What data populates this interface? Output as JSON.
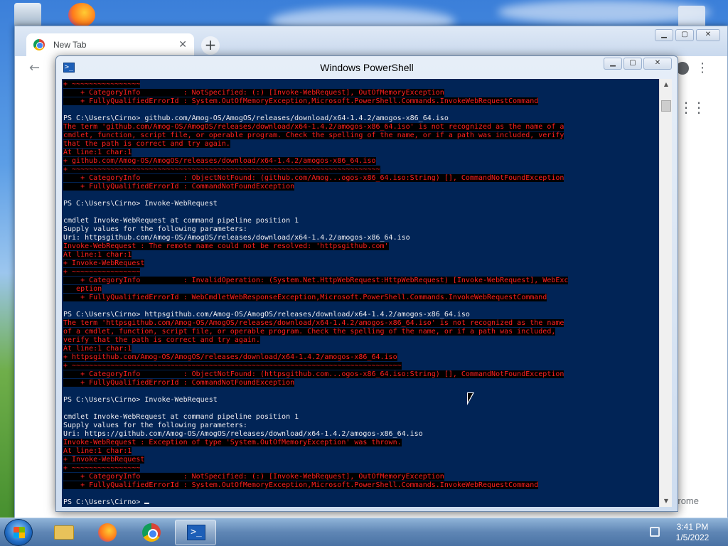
{
  "chrome": {
    "tab_title": "New Tab",
    "tab_close": "✕",
    "new_tab": "+",
    "back": "←",
    "menu": "⋮",
    "apps": "⋮⋮⋮",
    "footer_text": "rome"
  },
  "powershell": {
    "title": "Windows PowerShell",
    "icon": ">_",
    "lines": [
      {
        "t": "+ ~~~~~~~~~~~~~~~~",
        "e": true
      },
      {
        "t": "    + CategoryInfo          : NotSpecified: (:) [Invoke-WebRequest], OutOfMemoryException",
        "e": true
      },
      {
        "t": "    + FullyQualifiedErrorId : System.OutOfMemoryException,Microsoft.PowerShell.Commands.InvokeWebRequestCommand",
        "e": true
      },
      {
        "t": "",
        "e": false
      },
      {
        "t": "PS C:\\Users\\Cirno> github.com/Amog-OS/AmogOS/releases/download/x64-1.4.2/amogos-x86_64.iso",
        "e": false
      },
      {
        "t": "The term 'github.com/Amog-OS/AmogOS/releases/download/x64-1.4.2/amogos-x86_64.iso' is not recognized as the name of a",
        "e": true
      },
      {
        "t": "cmdlet, function, script file, or operable program. Check the spelling of the name, or if a path was included, verify",
        "e": true
      },
      {
        "t": "that the path is correct and try again.",
        "e": true
      },
      {
        "t": "At line:1 char:1",
        "e": true
      },
      {
        "t": "+ github.com/Amog-OS/AmogOS/releases/download/x64-1.4.2/amogos-x86_64.iso",
        "e": true
      },
      {
        "t": "+ ~~~~~~~~~~~~~~~~~~~~~~~~~~~~~~~~~~~~~~~~~~~~~~~~~~~~~~~~~~~~~~~~~~~~~~~~",
        "e": true
      },
      {
        "t": "    + CategoryInfo          : ObjectNotFound: (github.com/Amog...ogos-x86_64.iso:String) [], CommandNotFoundException",
        "e": true
      },
      {
        "t": "    + FullyQualifiedErrorId : CommandNotFoundException",
        "e": true
      },
      {
        "t": "",
        "e": false
      },
      {
        "t": "PS C:\\Users\\Cirno> Invoke-WebRequest",
        "e": false
      },
      {
        "t": "",
        "e": false
      },
      {
        "t": "cmdlet Invoke-WebRequest at command pipeline position 1",
        "e": false
      },
      {
        "t": "Supply values for the following parameters:",
        "e": false
      },
      {
        "t": "Uri: httpsgithub.com/Amog-OS/AmogOS/releases/download/x64-1.4.2/amogos-x86_64.iso",
        "e": false
      },
      {
        "t": "Invoke-WebRequest : The remote name could not be resolved: 'httpsgithub.com'",
        "e": true
      },
      {
        "t": "At line:1 char:1",
        "e": true
      },
      {
        "t": "+ Invoke-WebRequest",
        "e": true
      },
      {
        "t": "+ ~~~~~~~~~~~~~~~~",
        "e": true
      },
      {
        "t": "    + CategoryInfo          : InvalidOperation: (System.Net.HttpWebRequest:HttpWebRequest) [Invoke-WebRequest], WebExc",
        "e": true
      },
      {
        "t": "   eption",
        "e": true
      },
      {
        "t": "    + FullyQualifiedErrorId : WebCmdletWebResponseException,Microsoft.PowerShell.Commands.InvokeWebRequestCommand",
        "e": true
      },
      {
        "t": "",
        "e": false
      },
      {
        "t": "PS C:\\Users\\Cirno> httpsgithub.com/Amog-OS/AmogOS/releases/download/x64-1.4.2/amogos-x86_64.iso",
        "e": false
      },
      {
        "t": "The term 'httpsgithub.com/Amog-OS/AmogOS/releases/download/x64-1.4.2/amogos-x86_64.iso' is not recognized as the name",
        "e": true
      },
      {
        "t": "of a cmdlet, function, script file, or operable program. Check the spelling of the name, or if a path was included,",
        "e": true
      },
      {
        "t": "verify that the path is correct and try again.",
        "e": true
      },
      {
        "t": "At line:1 char:1",
        "e": true
      },
      {
        "t": "+ httpsgithub.com/Amog-OS/AmogOS/releases/download/x64-1.4.2/amogos-x86_64.iso",
        "e": true
      },
      {
        "t": "+ ~~~~~~~~~~~~~~~~~~~~~~~~~~~~~~~~~~~~~~~~~~~~~~~~~~~~~~~~~~~~~~~~~~~~~~~~~~~~~",
        "e": true
      },
      {
        "t": "    + CategoryInfo          : ObjectNotFound: (httpsgithub.com...ogos-x86_64.iso:String) [], CommandNotFoundException",
        "e": true
      },
      {
        "t": "    + FullyQualifiedErrorId : CommandNotFoundException",
        "e": true
      },
      {
        "t": "",
        "e": false
      },
      {
        "t": "PS C:\\Users\\Cirno> Invoke-WebRequest",
        "e": false
      },
      {
        "t": "",
        "e": false
      },
      {
        "t": "cmdlet Invoke-WebRequest at command pipeline position 1",
        "e": false
      },
      {
        "t": "Supply values for the following parameters:",
        "e": false
      },
      {
        "t": "Uri: https://github.com/Amog-OS/AmogOS/releases/download/x64-1.4.2/amogos-x86_64.iso",
        "e": false
      },
      {
        "t": "Invoke-WebRequest : Exception of type 'System.OutOfMemoryException' was thrown.",
        "e": true
      },
      {
        "t": "At line:1 char:1",
        "e": true
      },
      {
        "t": "+ Invoke-WebRequest",
        "e": true
      },
      {
        "t": "+ ~~~~~~~~~~~~~~~~",
        "e": true
      },
      {
        "t": "    + CategoryInfo          : NotSpecified: (:) [Invoke-WebRequest], OutOfMemoryException",
        "e": true
      },
      {
        "t": "    + FullyQualifiedErrorId : System.OutOfMemoryException,Microsoft.PowerShell.Commands.InvokeWebRequestCommand",
        "e": true
      },
      {
        "t": "",
        "e": false
      }
    ],
    "prompt": "PS C:\\Users\\Cirno> "
  },
  "window_buttons": {
    "minimize": "▁",
    "maximize": "▢",
    "close": "✕"
  },
  "scrollbar": {
    "up": "▲",
    "down": "▼"
  },
  "taskbar": {
    "apps": [
      {
        "name": "explorer-taskbar-button",
        "active": false
      },
      {
        "name": "firefox-taskbar-button",
        "active": false
      },
      {
        "name": "chrome-taskbar-button",
        "active": false
      },
      {
        "name": "powershell-taskbar-button",
        "active": true
      }
    ],
    "time": "3:41 PM",
    "date": "1/5/2022"
  },
  "colors": {
    "console_bg": "#012456",
    "console_fg": "#eeedf0",
    "error_fg": "#ff2020",
    "error_bg": "#000000"
  }
}
